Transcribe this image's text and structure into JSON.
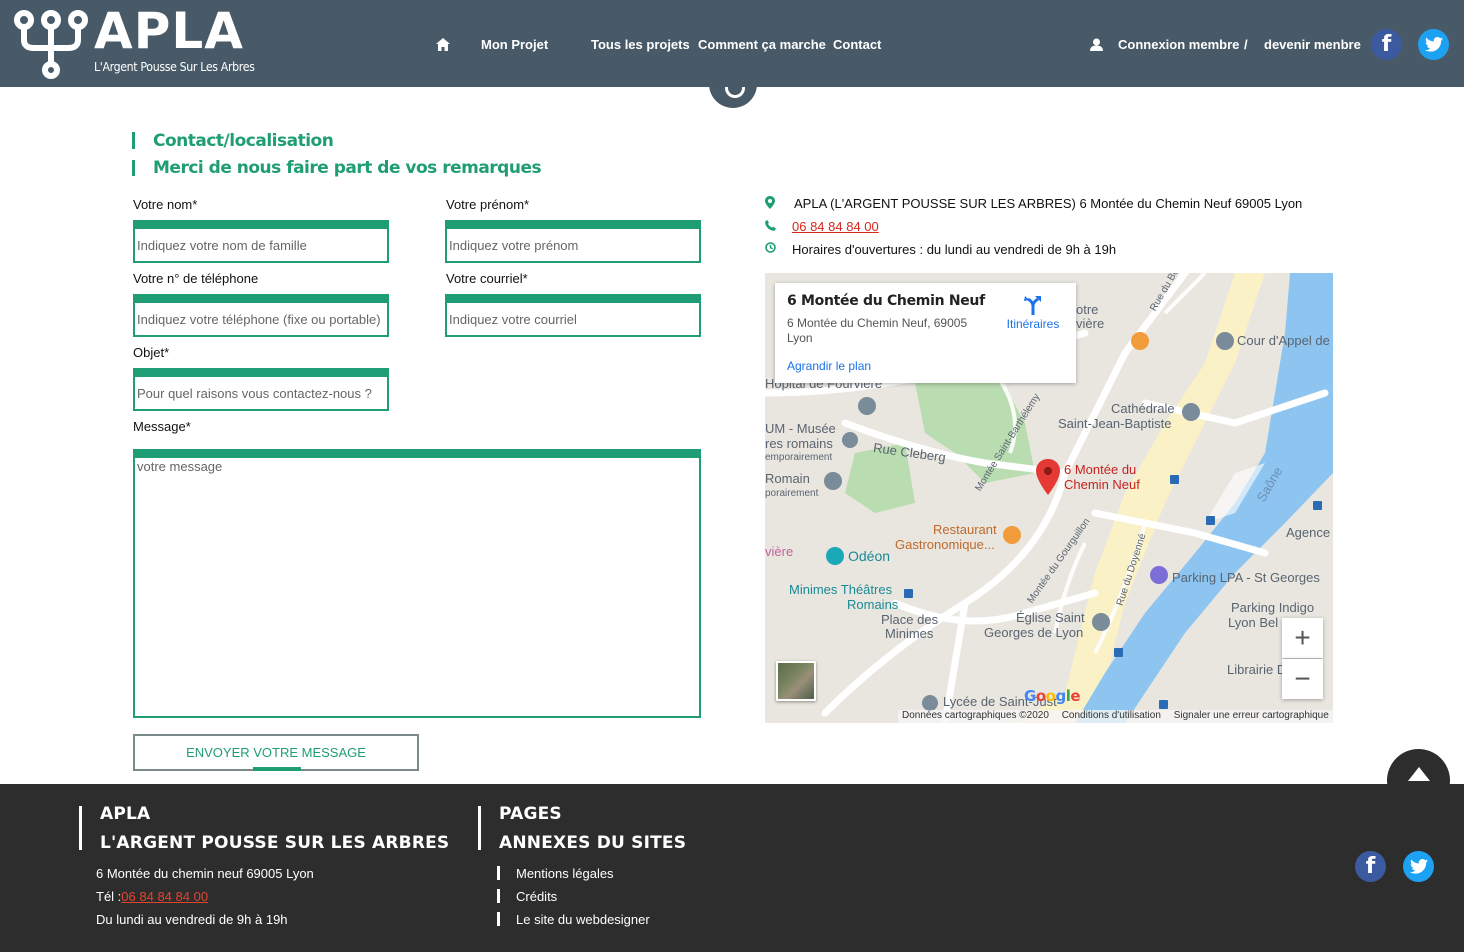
{
  "header": {
    "brand": "APLA",
    "tagline": "L'Argent Pousse Sur Les Arbres",
    "nav": {
      "home_icon": "home-icon",
      "mon_projet": "Mon Projet",
      "tous_les_projets": "Tous les projets",
      "comment_ca_marche": "Comment ça marche",
      "contact": "Contact"
    },
    "account": {
      "user_icon": "user-icon",
      "login": "Connexion membre",
      "separator": "/",
      "register": "devenir menbre"
    },
    "social": {
      "facebook": "f",
      "twitter": "twitter-icon"
    },
    "colors": {
      "bar": "#485a67",
      "facebook": "#3b5aa0",
      "twitter": "#1da1f2"
    }
  },
  "heading": {
    "title": "Contact/localisation",
    "subtitle": "Merci de nous faire part de vos remarques",
    "accent": "#1f9d74"
  },
  "form": {
    "nom": {
      "label": "Votre nom*",
      "placeholder": "Indiquez votre nom de famille",
      "value": ""
    },
    "prenom": {
      "label": "Votre prénom*",
      "placeholder": "Indiquez votre prénom",
      "value": ""
    },
    "telephone": {
      "label": "Votre n° de téléphone",
      "placeholder": "Indiquez votre téléphone (fixe ou portable)",
      "value": ""
    },
    "courriel": {
      "label": "Votre courriel*",
      "placeholder": "Indiquez votre courriel",
      "value": ""
    },
    "objet": {
      "label": "Objet*",
      "placeholder": "Pour quel raisons vous contactez-nous ?",
      "value": ""
    },
    "message": {
      "label": "Message*",
      "placeholder": "votre message",
      "value": ""
    },
    "submit": "ENVOYER VOTRE MESSAGE"
  },
  "contact_info": {
    "address": "APLA (L'ARGENT POUSSE SUR LES ARBRES) 6 Montée du Chemin Neuf 69005 Lyon",
    "phone": "06 84 84 84 00",
    "hours": "Horaires d'ouvertures : du lundi au vendredi de 9h à 19h",
    "icons": [
      "map-pin-icon",
      "phone-icon",
      "clock-icon"
    ]
  },
  "map": {
    "card": {
      "title": "6 Montée du Chemin Neuf",
      "address": "6 Montée du Chemin Neuf, 69005 Lyon",
      "directions": "Itinéraires",
      "enlarge": "Agrandir le plan"
    },
    "labels": {
      "otre": "otre",
      "viere": "vière",
      "rue_du_boeuf": "Rue du Bœuf",
      "cour_appel": "Cour d'Appel de",
      "hopital": "Hôpital de Fourvière",
      "cathedrale": "Cathédrale",
      "saint_jean": "Saint-Jean-Baptiste",
      "um_musee": "UM - Musée",
      "res_romains": "res romains",
      "emporaire": "emporairement",
      "rue_cleberg": "Rue Cleberg",
      "montee_st_barth": "Montée Saint-Barthélemy",
      "romain": "Romain",
      "poraire": "porairement",
      "pin_label": "6 Montée du Chemin Neuf",
      "saone": "Saône",
      "agence": "Agence",
      "restaurant": "Restaurant",
      "gastronomique": "Gastronomique...",
      "viere2": "vière",
      "odeon": "Odéon",
      "montee_gourguillon": "Montée du Gourguillon",
      "rue_doyenne": "Rue du Doyenné",
      "parking_lpa": "Parking LPA - St Georges",
      "minimes_theatres": "Minimes Théâtres",
      "romains": "Romains",
      "place_des": "Place des",
      "minimes": "Minimes",
      "eglise": "Église Saint",
      "georges": "Georges de Lyon",
      "parking_indigo": "Parking Indigo",
      "lyon_bel": "Lyon Bel",
      "librairie": "Librairie Deci",
      "lycee": "Lycée de Saint-Just",
      "google": "Google"
    },
    "footer": {
      "data": "Données cartographiques ©2020",
      "terms": "Conditions d'utilisation",
      "report": "Signaler une erreur cartographique"
    },
    "zoom_in": "+",
    "zoom_out": "−"
  },
  "footer": {
    "col1": {
      "title1": "APLA",
      "title2": "L'ARGENT POUSSE SUR LES ARBRES",
      "address": "6 Montée du chemin neuf 69005 Lyon",
      "tel_label": "Tél :",
      "tel": "06 84 84 84 00",
      "hours": "Du lundi au vendredi de 9h à 19h"
    },
    "col2": {
      "title1": "PAGES",
      "title2": "ANNEXES DU SITES",
      "links": [
        "Mentions légales",
        "Crédits",
        "Le site du webdesigner"
      ]
    },
    "social": {
      "facebook": "f",
      "twitter": "twitter-icon"
    }
  }
}
